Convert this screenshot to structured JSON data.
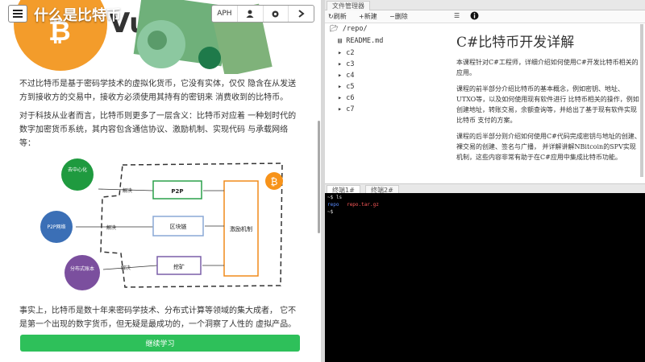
{
  "site": {
    "title": "什么是比特币",
    "toolbar": {
      "api_label": "APH"
    }
  },
  "article": {
    "para1": "不过比特币是基于密码学技术的虚拟化货币，它没有实体，仅仅 隐含在从发送方到接收方的交易中，接收方必须使用其持有的密钥来 消费收到的比特币。",
    "para2": "对于科技从业者而言，比特币则更多了一层含义：比特币对应着 一种划时代的数字加密货币系统，其内容包含通信协议、激励机制、实现代码 与承载网络等：",
    "para3": "事实上，比特币是数十年来密码学技术、分布式计算等领域的集大成者， 它不是第一个出现的数字货币，但无疑是最成功的，一个洞察了人性的 虚拟产品。",
    "continue_label": "继续学习"
  },
  "diagram": {
    "circles": [
      {
        "label": "去中心化",
        "color": "#1f9a3f"
      },
      {
        "label": "P2P网络",
        "color": "#3b6fb6"
      },
      {
        "label": "分布式账本",
        "color": "#7b4f9e"
      }
    ],
    "boxes": [
      {
        "label": "P2P"
      },
      {
        "label": "区块链"
      },
      {
        "label": "挖矿"
      }
    ],
    "arrow_labels": [
      "解决",
      "解决",
      "解决"
    ],
    "incentive_label": "激励机制",
    "bitcoin_badge": "₿",
    "colors": {
      "p2p_border": "#2aa04a",
      "chain_border": "#8aa9d6",
      "mine_border": "#7a5fa8",
      "incentive_border": "#f08a1a",
      "bitcoin": "#f7931a"
    }
  },
  "file_manager": {
    "tab_label": "文件管理器",
    "actions": {
      "refresh": "刷新",
      "new": "新建",
      "delete": "删除"
    },
    "root": "/repo/",
    "readme": "README.md",
    "folders": [
      "c2",
      "c3",
      "c4",
      "c5",
      "c6",
      "c7"
    ]
  },
  "readme": {
    "title": "C#比特币开发详解",
    "p1": "本课程针对C#工程师，详细介绍如何使用C#开发比特币相关的应用。",
    "p2": "课程的前半部分介绍比特币的基本概念，例如密钥、地址、UTXO等，以及如何使用现有软件进行 比特币相关的操作，例如创建地址，转账交易，余额查询等，并给出了基于现有软件实现比特币 支付的方案。",
    "p3": "课程的后半部分则介绍如何使用C#代码完成密钥与地址的创建、裸交易的创建、签名与广播， 并详解讲解NBitcoin的SPV实现机制，这些内容非常有助于在C#应用中集成比特币功能。"
  },
  "terminal": {
    "tab1": "终端1#",
    "tab2": "终端2#",
    "line1": "~$ ls",
    "line2_dir": "repo",
    "line2_file": "repo.tar.gz",
    "line3": "~$"
  }
}
